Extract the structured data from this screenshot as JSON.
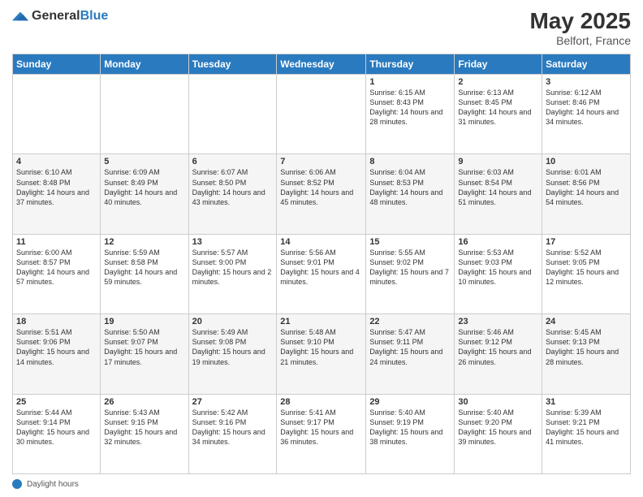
{
  "header": {
    "logo_general": "General",
    "logo_blue": "Blue",
    "month_year": "May 2025",
    "location": "Belfort, France"
  },
  "days_of_week": [
    "Sunday",
    "Monday",
    "Tuesday",
    "Wednesday",
    "Thursday",
    "Friday",
    "Saturday"
  ],
  "weeks": [
    [
      {
        "day": "",
        "sunrise": "",
        "sunset": "",
        "daylight": ""
      },
      {
        "day": "",
        "sunrise": "",
        "sunset": "",
        "daylight": ""
      },
      {
        "day": "",
        "sunrise": "",
        "sunset": "",
        "daylight": ""
      },
      {
        "day": "",
        "sunrise": "",
        "sunset": "",
        "daylight": ""
      },
      {
        "day": "1",
        "sunrise": "Sunrise: 6:15 AM",
        "sunset": "Sunset: 8:43 PM",
        "daylight": "Daylight: 14 hours and 28 minutes."
      },
      {
        "day": "2",
        "sunrise": "Sunrise: 6:13 AM",
        "sunset": "Sunset: 8:45 PM",
        "daylight": "Daylight: 14 hours and 31 minutes."
      },
      {
        "day": "3",
        "sunrise": "Sunrise: 6:12 AM",
        "sunset": "Sunset: 8:46 PM",
        "daylight": "Daylight: 14 hours and 34 minutes."
      }
    ],
    [
      {
        "day": "4",
        "sunrise": "Sunrise: 6:10 AM",
        "sunset": "Sunset: 8:48 PM",
        "daylight": "Daylight: 14 hours and 37 minutes."
      },
      {
        "day": "5",
        "sunrise": "Sunrise: 6:09 AM",
        "sunset": "Sunset: 8:49 PM",
        "daylight": "Daylight: 14 hours and 40 minutes."
      },
      {
        "day": "6",
        "sunrise": "Sunrise: 6:07 AM",
        "sunset": "Sunset: 8:50 PM",
        "daylight": "Daylight: 14 hours and 43 minutes."
      },
      {
        "day": "7",
        "sunrise": "Sunrise: 6:06 AM",
        "sunset": "Sunset: 8:52 PM",
        "daylight": "Daylight: 14 hours and 45 minutes."
      },
      {
        "day": "8",
        "sunrise": "Sunrise: 6:04 AM",
        "sunset": "Sunset: 8:53 PM",
        "daylight": "Daylight: 14 hours and 48 minutes."
      },
      {
        "day": "9",
        "sunrise": "Sunrise: 6:03 AM",
        "sunset": "Sunset: 8:54 PM",
        "daylight": "Daylight: 14 hours and 51 minutes."
      },
      {
        "day": "10",
        "sunrise": "Sunrise: 6:01 AM",
        "sunset": "Sunset: 8:56 PM",
        "daylight": "Daylight: 14 hours and 54 minutes."
      }
    ],
    [
      {
        "day": "11",
        "sunrise": "Sunrise: 6:00 AM",
        "sunset": "Sunset: 8:57 PM",
        "daylight": "Daylight: 14 hours and 57 minutes."
      },
      {
        "day": "12",
        "sunrise": "Sunrise: 5:59 AM",
        "sunset": "Sunset: 8:58 PM",
        "daylight": "Daylight: 14 hours and 59 minutes."
      },
      {
        "day": "13",
        "sunrise": "Sunrise: 5:57 AM",
        "sunset": "Sunset: 9:00 PM",
        "daylight": "Daylight: 15 hours and 2 minutes."
      },
      {
        "day": "14",
        "sunrise": "Sunrise: 5:56 AM",
        "sunset": "Sunset: 9:01 PM",
        "daylight": "Daylight: 15 hours and 4 minutes."
      },
      {
        "day": "15",
        "sunrise": "Sunrise: 5:55 AM",
        "sunset": "Sunset: 9:02 PM",
        "daylight": "Daylight: 15 hours and 7 minutes."
      },
      {
        "day": "16",
        "sunrise": "Sunrise: 5:53 AM",
        "sunset": "Sunset: 9:03 PM",
        "daylight": "Daylight: 15 hours and 10 minutes."
      },
      {
        "day": "17",
        "sunrise": "Sunrise: 5:52 AM",
        "sunset": "Sunset: 9:05 PM",
        "daylight": "Daylight: 15 hours and 12 minutes."
      }
    ],
    [
      {
        "day": "18",
        "sunrise": "Sunrise: 5:51 AM",
        "sunset": "Sunset: 9:06 PM",
        "daylight": "Daylight: 15 hours and 14 minutes."
      },
      {
        "day": "19",
        "sunrise": "Sunrise: 5:50 AM",
        "sunset": "Sunset: 9:07 PM",
        "daylight": "Daylight: 15 hours and 17 minutes."
      },
      {
        "day": "20",
        "sunrise": "Sunrise: 5:49 AM",
        "sunset": "Sunset: 9:08 PM",
        "daylight": "Daylight: 15 hours and 19 minutes."
      },
      {
        "day": "21",
        "sunrise": "Sunrise: 5:48 AM",
        "sunset": "Sunset: 9:10 PM",
        "daylight": "Daylight: 15 hours and 21 minutes."
      },
      {
        "day": "22",
        "sunrise": "Sunrise: 5:47 AM",
        "sunset": "Sunset: 9:11 PM",
        "daylight": "Daylight: 15 hours and 24 minutes."
      },
      {
        "day": "23",
        "sunrise": "Sunrise: 5:46 AM",
        "sunset": "Sunset: 9:12 PM",
        "daylight": "Daylight: 15 hours and 26 minutes."
      },
      {
        "day": "24",
        "sunrise": "Sunrise: 5:45 AM",
        "sunset": "Sunset: 9:13 PM",
        "daylight": "Daylight: 15 hours and 28 minutes."
      }
    ],
    [
      {
        "day": "25",
        "sunrise": "Sunrise: 5:44 AM",
        "sunset": "Sunset: 9:14 PM",
        "daylight": "Daylight: 15 hours and 30 minutes."
      },
      {
        "day": "26",
        "sunrise": "Sunrise: 5:43 AM",
        "sunset": "Sunset: 9:15 PM",
        "daylight": "Daylight: 15 hours and 32 minutes."
      },
      {
        "day": "27",
        "sunrise": "Sunrise: 5:42 AM",
        "sunset": "Sunset: 9:16 PM",
        "daylight": "Daylight: 15 hours and 34 minutes."
      },
      {
        "day": "28",
        "sunrise": "Sunrise: 5:41 AM",
        "sunset": "Sunset: 9:17 PM",
        "daylight": "Daylight: 15 hours and 36 minutes."
      },
      {
        "day": "29",
        "sunrise": "Sunrise: 5:40 AM",
        "sunset": "Sunset: 9:19 PM",
        "daylight": "Daylight: 15 hours and 38 minutes."
      },
      {
        "day": "30",
        "sunrise": "Sunrise: 5:40 AM",
        "sunset": "Sunset: 9:20 PM",
        "daylight": "Daylight: 15 hours and 39 minutes."
      },
      {
        "day": "31",
        "sunrise": "Sunrise: 5:39 AM",
        "sunset": "Sunset: 9:21 PM",
        "daylight": "Daylight: 15 hours and 41 minutes."
      }
    ]
  ],
  "footer": {
    "daylight_hours_label": "Daylight hours"
  }
}
